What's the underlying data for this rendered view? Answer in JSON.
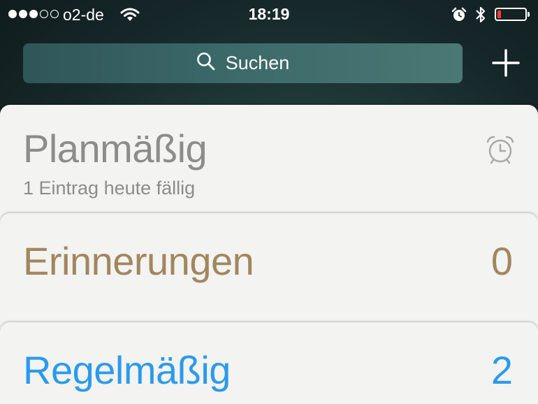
{
  "status_bar": {
    "signal_strength": "3 of 5",
    "carrier": "o2-de",
    "time": "18:19",
    "battery_level": 0.12,
    "icons": [
      "wifi-icon",
      "alarm-icon",
      "bluetooth-icon",
      "battery-icon"
    ]
  },
  "search": {
    "label": "Suchen",
    "icon": "search-icon"
  },
  "add_button": {
    "icon": "plus-icon"
  },
  "lists": [
    {
      "title": "Planmäßig",
      "subtitle": "1 Eintrag heute fällig",
      "icon": "alarm-clock-icon",
      "color": "#8c8c8c"
    },
    {
      "title": "Erinnerungen",
      "count": "0",
      "color": "#a2865e"
    },
    {
      "title": "Regelmäßig",
      "count": "2",
      "color": "#2a9bee"
    }
  ],
  "colors": {
    "battery_low": "#ff3b30",
    "card_background": "#f3f3f1"
  }
}
